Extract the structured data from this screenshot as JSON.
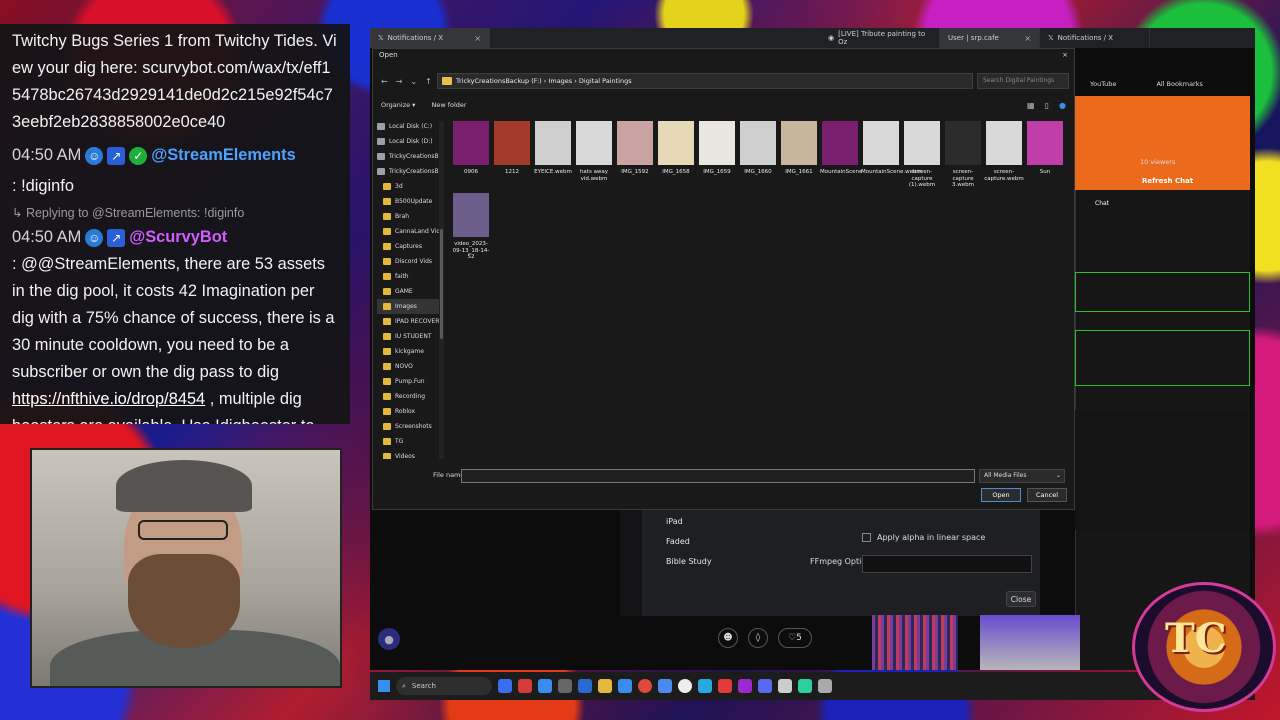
{
  "chat": {
    "first_msg": "Twitchy Bugs Series 1 from Twitchy Tides. View your dig here: scurvybot.com/wax/tx/eff15478bc26743d2929141de0d2c215e92f54c73eebf2eb2838858002e0ce40",
    "msg2_time": "04:50 AM",
    "msg2_user": "@StreamElements",
    "msg2_text": ": !diginfo",
    "reply_text": "Replying to @StreamElements: !diginfo",
    "msg3_time": "04:50 AM",
    "msg3_user": "@ScurvyBot",
    "msg3_text_a": ": @@StreamElements, there are 53 assets in the dig pool, it costs 42 Imagination per dig with a 75% chance of success, there is a 30 minute cooldown, you need to be a subscriber or own the dig pass to dig ",
    "msg3_link": "https://nfthive.io/drop/8454",
    "msg3_text_b": " , multiple dig boosters are available. Use !digbooster to see details"
  },
  "browser": {
    "tabs": [
      {
        "label": "Notifications / X"
      },
      {
        "label": "[LIVE] Tribute painting to Oz"
      },
      {
        "label": "User | srp.cafe"
      },
      {
        "label": "Notifications / X"
      }
    ],
    "bookmarks": [
      "YouTube",
      "All Bookmarks"
    ]
  },
  "dialog": {
    "title": "Open",
    "path": "TrickyCreationsBackup (F:)  ›  Images  ›  Digital Paintings",
    "search_placeholder": "Search Digital Paintings",
    "organize": "Organize ▾",
    "new_folder": "New folder",
    "tree": [
      {
        "label": "Local Disk (C:)",
        "type": "drive"
      },
      {
        "label": "Local Disk (D:)",
        "type": "drive"
      },
      {
        "label": "TrickyCreationsB",
        "type": "drive"
      },
      {
        "label": "TrickyCreationsBa",
        "type": "drive"
      },
      {
        "label": "3d",
        "type": "folder"
      },
      {
        "label": "B500Update",
        "type": "folder"
      },
      {
        "label": "Brah",
        "type": "folder"
      },
      {
        "label": "CannaLand Vide",
        "type": "folder"
      },
      {
        "label": "Captures",
        "type": "folder"
      },
      {
        "label": "Discord Vids",
        "type": "folder"
      },
      {
        "label": "faith",
        "type": "folder"
      },
      {
        "label": "GAME",
        "type": "folder"
      },
      {
        "label": "Images",
        "type": "folder"
      },
      {
        "label": "IPAD RECOVERY",
        "type": "folder"
      },
      {
        "label": "IU STUDENT",
        "type": "folder"
      },
      {
        "label": "kickgame",
        "type": "folder"
      },
      {
        "label": "NOVO",
        "type": "folder"
      },
      {
        "label": "Pump.Fun",
        "type": "folder"
      },
      {
        "label": "Recording",
        "type": "folder"
      },
      {
        "label": "Roblox",
        "type": "folder"
      },
      {
        "label": "Screenshots",
        "type": "folder"
      },
      {
        "label": "TG",
        "type": "folder"
      },
      {
        "label": "Videos",
        "type": "folder"
      }
    ],
    "files": [
      {
        "name": "0906",
        "color": "#7a1e6e"
      },
      {
        "name": "1212",
        "color": "#a43a2a"
      },
      {
        "name": "EYEICE.webm",
        "color": "#cfcfcf"
      },
      {
        "name": "hats away vid.webm",
        "color": "#d8d8d8"
      },
      {
        "name": "IMG_1592",
        "color": "#c9a2a2"
      },
      {
        "name": "IMG_1658",
        "color": "#e6d9b8"
      },
      {
        "name": "IMG_1659",
        "color": "#e9e6e2"
      },
      {
        "name": "IMG_1660",
        "color": "#cfcfcf"
      },
      {
        "name": "IMG_1661",
        "color": "#c9b69d"
      },
      {
        "name": "MountainScene",
        "color": "#7a1e6e"
      },
      {
        "name": "MountainScene.webm",
        "color": "#d9d9d9"
      },
      {
        "name": "screen-capture (1).webm",
        "color": "#d9d9d9"
      },
      {
        "name": "screen-capture 3.webm",
        "color": "#2c2c2c"
      },
      {
        "name": "screen-capture.webm",
        "color": "#d9d9d9"
      },
      {
        "name": "Sun",
        "color": "#c03ea8"
      },
      {
        "name": "video_2023-09-13_18-14-52",
        "color": "#6d5d8a"
      }
    ],
    "file_name_label": "File name:",
    "file_name_value": "",
    "file_type": "All Media Files",
    "open_label": "Open",
    "cancel_label": "Cancel"
  },
  "right_chat": {
    "viewers": "10 viewers",
    "refresh": "Refresh Chat",
    "tab": "Chat"
  },
  "obs": {
    "list": [
      "iPad",
      "Faded",
      "Bible Study"
    ],
    "alpha_label": "Apply alpha in linear space",
    "ffmpeg_label": "FFmpeg Options",
    "close_label": "Close",
    "reactions_count": "5"
  },
  "taskbar": {
    "search_label": "Search"
  },
  "logo": {
    "text": "TC",
    "caption": "TRICKY CREATIONS"
  }
}
